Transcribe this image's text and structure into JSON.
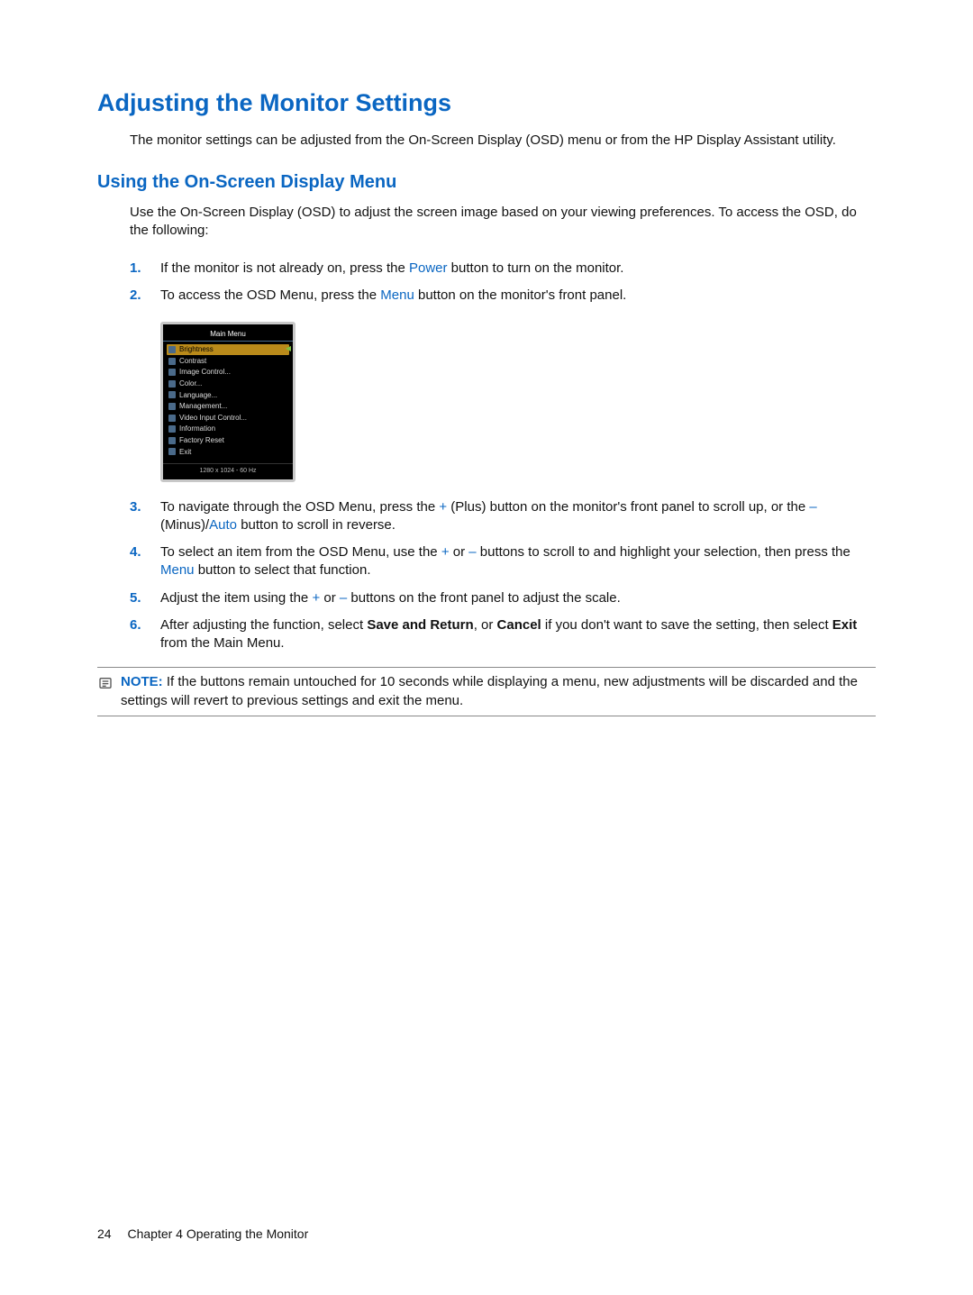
{
  "heading": "Adjusting the Monitor Settings",
  "intro": "The monitor settings can be adjusted from the On-Screen Display (OSD) menu or from the HP Display Assistant utility.",
  "subheading": "Using the On-Screen Display Menu",
  "subintro": "Use the On-Screen Display (OSD) to adjust the screen image based on your viewing preferences. To access the OSD, do the following:",
  "steps": {
    "s1": {
      "num": "1.",
      "a": "If the monitor is not already on, press the ",
      "kw1": "Power",
      "b": " button to turn on the monitor."
    },
    "s2": {
      "num": "2.",
      "a": "To access the OSD Menu, press the ",
      "kw1": "Menu",
      "b": " button on the monitor's front panel."
    },
    "s3": {
      "num": "3.",
      "a": "To navigate through the OSD Menu, press the ",
      "kw1": "+",
      "b": " (Plus) button on the monitor's front panel to scroll up, or the ",
      "kw2": "–",
      "c": " (Minus)/",
      "kw3": "Auto",
      "d": " button to scroll in reverse."
    },
    "s4": {
      "num": "4.",
      "a": "To select an item from the OSD Menu, use the ",
      "kw1": "+",
      "b": " or ",
      "kw2": "–",
      "c": " buttons to scroll to and highlight your selection, then press the ",
      "kw3": "Menu",
      "d": " button to select that function."
    },
    "s5": {
      "num": "5.",
      "a": "Adjust the item using the ",
      "kw1": "+",
      "b": " or ",
      "kw2": "–",
      "c": " buttons on the front panel to adjust the scale."
    },
    "s6": {
      "num": "6.",
      "a": "After adjusting the function, select ",
      "bold1": "Save and Return",
      "b": ", or ",
      "bold2": "Cancel",
      "c": " if you don't want to save the setting, then select ",
      "bold3": "Exit",
      "d": " from the Main Menu."
    }
  },
  "osd": {
    "title": "Main Menu",
    "items": [
      "Brightness",
      "Contrast",
      "Image Control...",
      "Color...",
      "Language...",
      "Management...",
      "Video Input Control...",
      "Information",
      "Factory Reset",
      "Exit"
    ],
    "footer": "1280 x 1024 - 60 Hz"
  },
  "note": {
    "label": "NOTE:",
    "text": "If the buttons remain untouched for 10 seconds while displaying a menu, new adjustments will be discarded and the settings will revert to previous settings and exit the menu."
  },
  "footer": {
    "page": "24",
    "chapter": "Chapter 4   Operating the Monitor"
  }
}
